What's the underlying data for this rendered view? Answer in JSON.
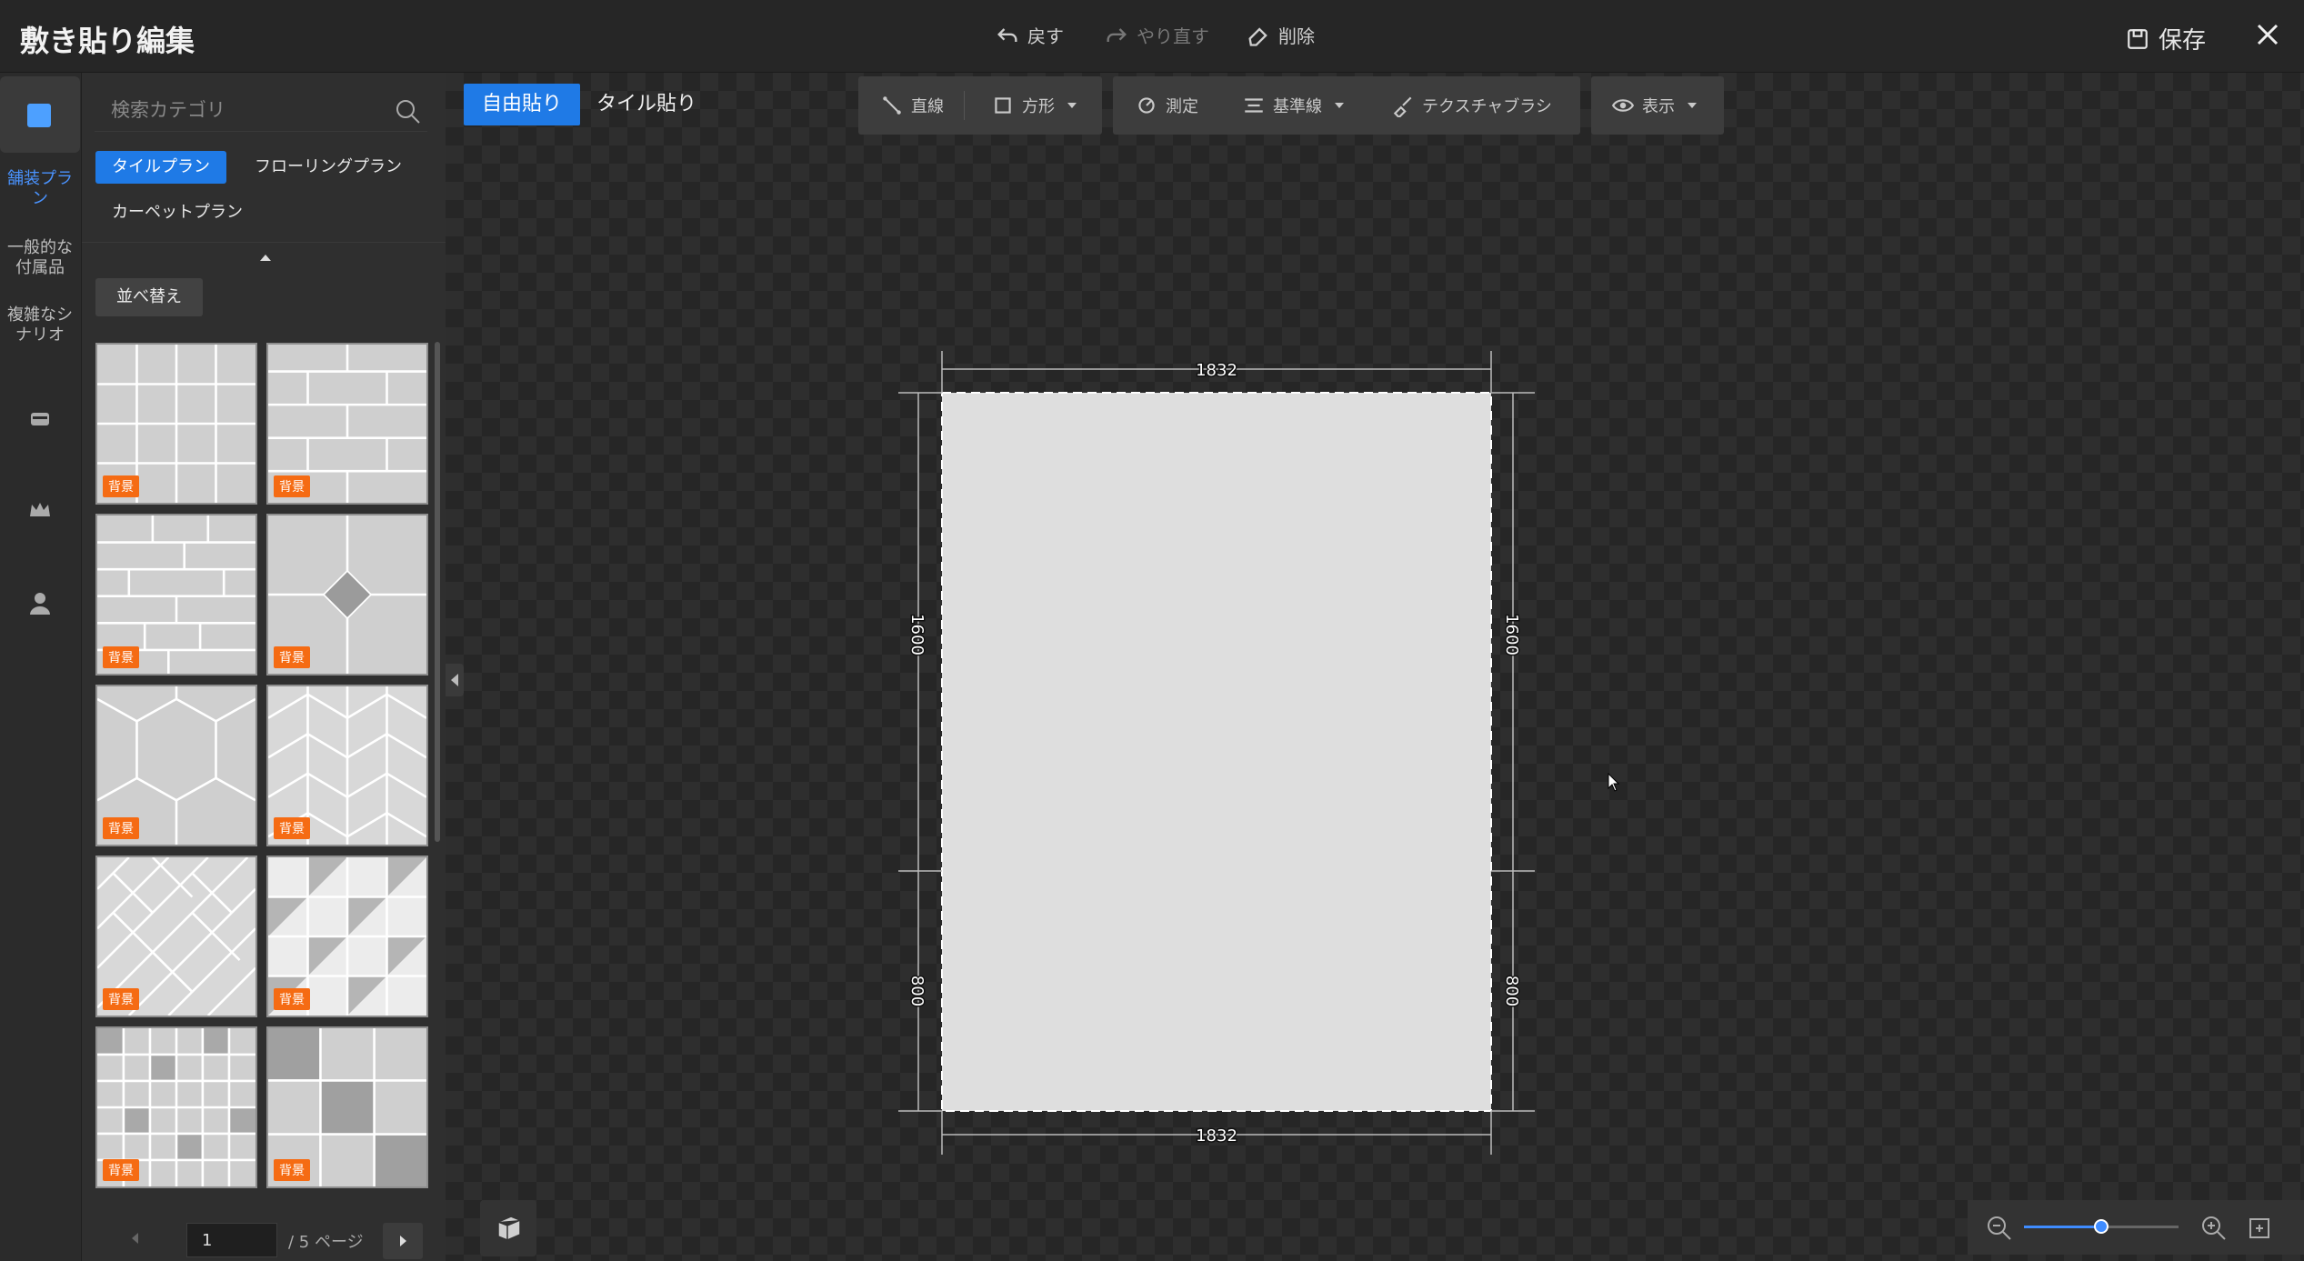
{
  "header": {
    "title": "敷き貼り編集",
    "undo_label": "戻す",
    "redo_label": "やり直す",
    "delete_label": "削除",
    "save_label": "保存"
  },
  "rail": {
    "items": [
      {
        "label": "舗装プラン",
        "active": true
      },
      {
        "label": "一般的な付属品",
        "active": false
      },
      {
        "label": "複雑なシナリオ",
        "active": false
      }
    ],
    "icons": [
      "layers-icon",
      "crown-icon",
      "user-icon"
    ]
  },
  "panel": {
    "search_placeholder": "検索カテゴリ",
    "chips": [
      "タイルプラン",
      "フローリングプラン",
      "カーペットプラン"
    ],
    "sort_label": "並べ替え",
    "tiles": [
      {
        "pattern": "square-grid",
        "badge": "背景"
      },
      {
        "pattern": "brick-running",
        "badge": "背景"
      },
      {
        "pattern": "brick-offset",
        "badge": "背景"
      },
      {
        "pattern": "diamond-insert",
        "badge": "背景"
      },
      {
        "pattern": "hexagon",
        "badge": "背景"
      },
      {
        "pattern": "herringbone-vertical",
        "badge": "背景"
      },
      {
        "pattern": "herringbone-diagonal",
        "badge": "背景"
      },
      {
        "pattern": "checker-triangles",
        "badge": "背景"
      },
      {
        "pattern": "small-mosaic",
        "badge": "背景"
      },
      {
        "pattern": "large-mosaic",
        "badge": "背景"
      }
    ],
    "pager": {
      "current": "1",
      "total_label": "/ 5 ページ"
    }
  },
  "modes": {
    "free": "自由貼り",
    "tile": "タイル貼り"
  },
  "toolbar": {
    "line": "直線",
    "rect": "方形",
    "measure": "測定",
    "baseline": "基準線",
    "texture": "テクスチャブラシ",
    "view": "表示"
  },
  "dimensions": {
    "top": "1832",
    "bottom": "1832",
    "left_upper": "1600",
    "left_lower": "800",
    "right_upper": "1600",
    "right_lower": "800"
  },
  "zoom": {
    "level": 0.5
  },
  "colors": {
    "accent": "#1f7ae6",
    "badge": "#f56b13",
    "plan_fill": "#dedede"
  }
}
